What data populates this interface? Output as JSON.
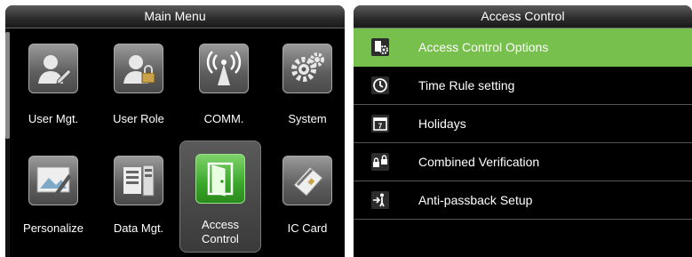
{
  "main_menu": {
    "title": "Main Menu",
    "tiles": [
      {
        "label": "User Mgt.",
        "icon": "user-management-icon"
      },
      {
        "label": "User Role",
        "icon": "user-role-icon"
      },
      {
        "label": "COMM.",
        "icon": "antenna-icon"
      },
      {
        "label": "System",
        "icon": "gears-icon"
      },
      {
        "label": "Personalize",
        "icon": "personalize-icon"
      },
      {
        "label": "Data Mgt.",
        "icon": "data-management-icon"
      },
      {
        "label": "Access Control",
        "line1": "Access",
        "line2": "Control",
        "icon": "door-icon"
      },
      {
        "label": "IC Card",
        "icon": "card-icon"
      }
    ],
    "selected": "Access Control"
  },
  "access_control": {
    "title": "Access Control",
    "items": [
      {
        "label": "Access Control Options",
        "icon": "options-icon"
      },
      {
        "label": "Time Rule setting",
        "icon": "clock-icon"
      },
      {
        "label": "Holidays",
        "icon": "calendar-icon"
      },
      {
        "label": "Combined Verification",
        "icon": "locks-icon"
      },
      {
        "label": "Anti-passback Setup",
        "icon": "anti-passback-icon"
      }
    ],
    "selected": "Access Control Options",
    "calendar_day": "7"
  },
  "colors": {
    "selected_row": "#78c04e",
    "selected_tile_icon": "#3aa82a",
    "background": "#000000"
  }
}
